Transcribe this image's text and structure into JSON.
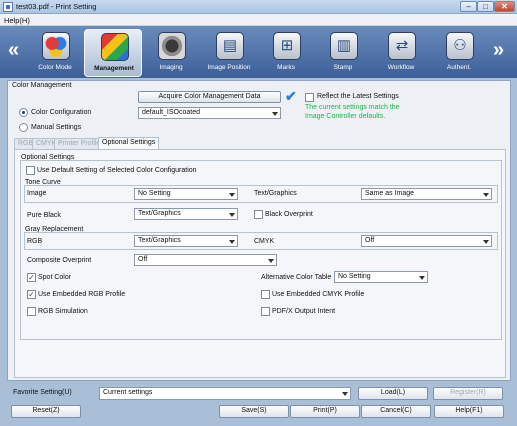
{
  "window": {
    "title": "test03.pdf - Print Setting",
    "min": "–",
    "max": "□",
    "close": "✕"
  },
  "menu": {
    "help": "Help(H)"
  },
  "toolbar": {
    "nav_left": "«",
    "nav_right": "»",
    "items": [
      {
        "label": "Color Mode",
        "icon": "color-mode-icon",
        "glyph": "◉"
      },
      {
        "label": "Management",
        "icon": "management-icon",
        "glyph": "◧"
      },
      {
        "label": "Imaging",
        "icon": "imaging-icon",
        "glyph": "▣"
      },
      {
        "label": "Image Position",
        "icon": "image-position-icon",
        "glyph": "▤"
      },
      {
        "label": "Marks",
        "icon": "marks-icon",
        "glyph": "⊞"
      },
      {
        "label": "Stamp",
        "icon": "stamp-icon",
        "glyph": "▥"
      },
      {
        "label": "Workflow",
        "icon": "workflow-icon",
        "glyph": "⇄"
      },
      {
        "label": "Authent.",
        "icon": "authentication-icon",
        "glyph": "⚇"
      }
    ],
    "active_index": 1
  },
  "color_management": {
    "group_label": "Color Management",
    "acquire_button": "Acquire Color Management Data",
    "checkmark": "✔",
    "reflect_latest": "Reflect the Latest Settings",
    "status_message_line1": "The current settings match the",
    "status_message_line2": "Image Controller defaults.",
    "color_configuration_label": "Color Configuration",
    "color_configuration_value": "default_ISOcoated",
    "manual_settings_label": "Manual Settings"
  },
  "tabs": [
    "RGB",
    "CMYK",
    "Printer Profile",
    "Optional Settings"
  ],
  "optional": {
    "group_label": "Optional Settings",
    "use_default": "Use Default Setting of Selected Color Configuration",
    "tone_curve_label": "Tone Curve",
    "image_label": "Image",
    "image_value": "No Setting",
    "text_graphics_label": "Text/Graphics",
    "text_graphics_value": "Same as Image",
    "pure_black_label": "Pure Black",
    "pure_black_value": "Text/Graphics",
    "black_overprint": "Black Overprint",
    "gray_replacement_label": "Gray Replacement",
    "rgb_label": "RGB",
    "rgb_value": "Text/Graphics",
    "cmyk_label": "CMYK",
    "cmyk_value": "Off",
    "composite_overprint_label": "Composite Overprint",
    "composite_overprint_value": "Off",
    "spot_color": "Spot Color",
    "alternative_color_table_label": "Alternative Color Table",
    "alternative_color_table_value": "No Setting",
    "use_embedded_rgb": "Use Embedded RGB Profile",
    "use_embedded_cmyk": "Use Embedded CMYK Profile",
    "rgb_simulation": "RGB Simulation",
    "pdfx_output_intent": "PDF/X Output Intent",
    "check_mark": "✓"
  },
  "footer": {
    "favorite_label": "Favorite Setting(U)",
    "favorite_value": "Current settings",
    "load": "Load(L)",
    "register": "Register(R)",
    "reset": "Reset(Z)",
    "save": "Save(S)",
    "print": "Print(P)",
    "cancel": "Cancel(C)",
    "help": "Help(F1)"
  },
  "colors": {
    "toolbar_top": "#6a8bbd",
    "toolbar_bottom": "#3c5f98",
    "status_green": "#22b14c",
    "check_blue": "#2a7fd4"
  }
}
